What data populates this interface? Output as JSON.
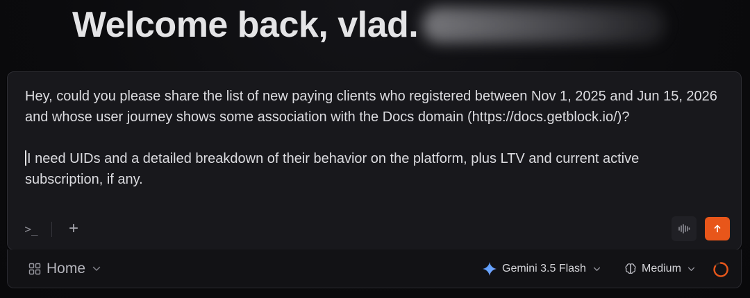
{
  "header": {
    "welcome_text": "Welcome back, vlad."
  },
  "composer": {
    "prompt_line1": "Hey, could you please share the list of new paying clients who registered between Nov 1, 2025 and Jun 15, 2026 and whose user journey shows some association with the Docs domain (https://docs.getblock.io/)?",
    "prompt_line2": "I need UIDs and a detailed breakdown of their behavior on the platform, plus LTV and current active subscription, if any.",
    "terminal_label": ">_",
    "add_label": "+",
    "send_icon": "arrow-up-icon",
    "voice_icon": "waveform-icon"
  },
  "bottom_bar": {
    "workspace_label": "Home",
    "model_label": "Gemini 3.5 Flash",
    "effort_label": "Medium"
  },
  "colors": {
    "accent": "#e8561a",
    "background": "#0b0b0d",
    "card": "#18181c"
  }
}
